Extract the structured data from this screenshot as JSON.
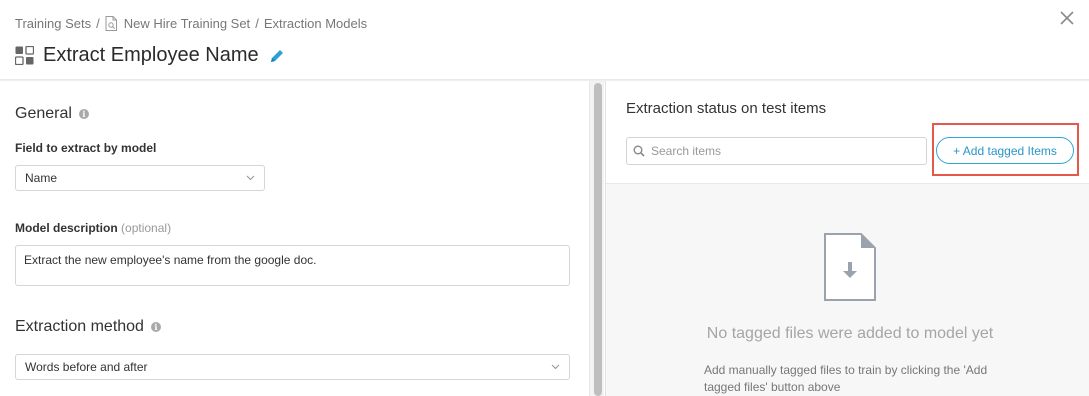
{
  "breadcrumb": {
    "items": [
      "Training Sets",
      "New Hire Training Set",
      "Extraction Models"
    ],
    "separator": "/"
  },
  "header": {
    "title": "Extract Employee Name",
    "close_icon": "close-icon",
    "edit_icon": "pencil-icon"
  },
  "general": {
    "heading": "General",
    "field_label": "Field to extract by model",
    "field_value": "Name",
    "description_label": "Model description",
    "description_optional": "(optional)",
    "description_value": "Extract the new employee's name from the google doc."
  },
  "extraction_method": {
    "heading": "Extraction method",
    "value": "Words before and after"
  },
  "right_panel": {
    "title": "Extraction status on test items",
    "search_placeholder": "Search items",
    "add_button_label": "+ Add tagged Items",
    "empty_title": "No tagged files were added to model yet",
    "empty_description": "Add manually tagged files to train by clicking the 'Add tagged files' button above"
  },
  "colors": {
    "accent": "#2fa6d3",
    "highlight": "#e5584a",
    "edit_icon": "#2f9fd6"
  }
}
